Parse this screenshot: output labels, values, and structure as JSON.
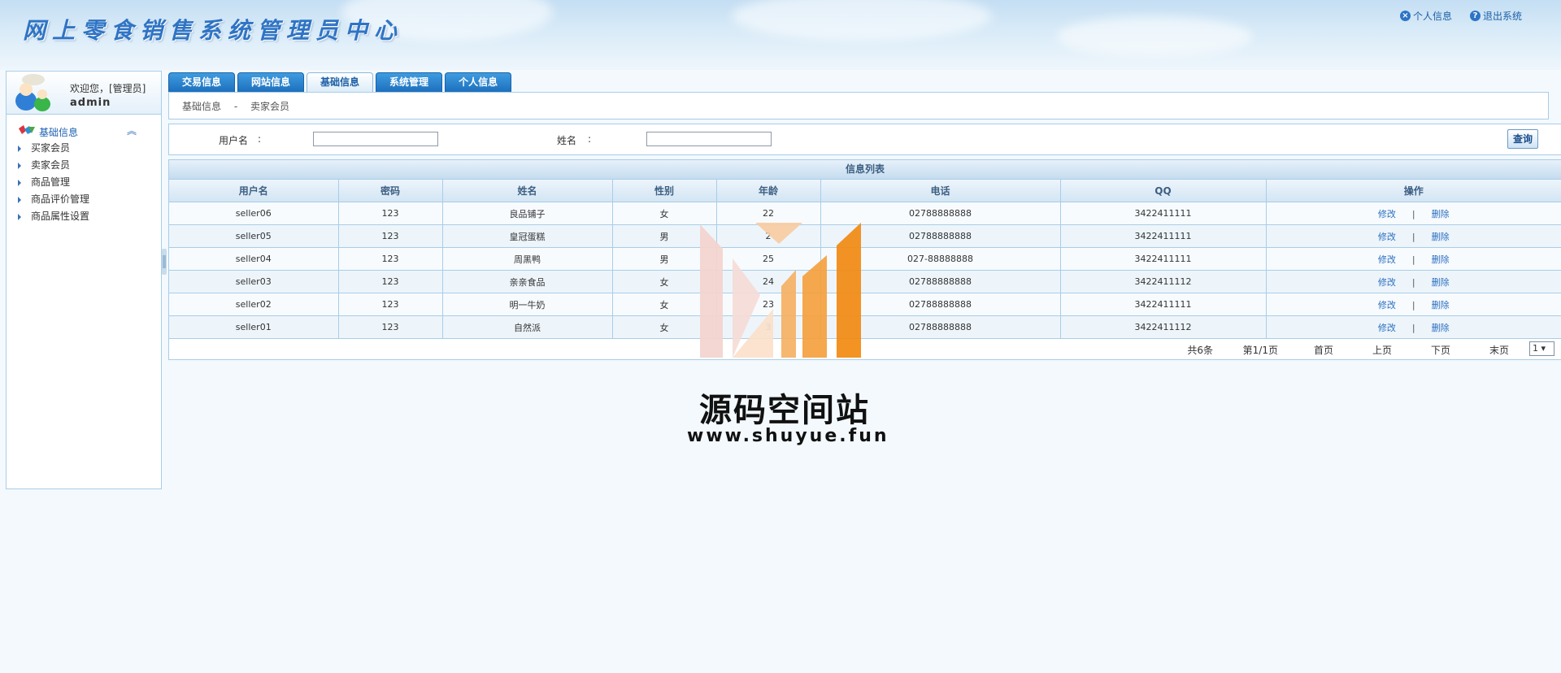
{
  "header": {
    "title": "网上零食销售系统管理员中心",
    "links": [
      {
        "label": "个人信息",
        "icon": "close-circle-icon"
      },
      {
        "label": "退出系统",
        "icon": "help-circle-icon"
      }
    ]
  },
  "sidebar": {
    "welcome": "欢迎您，[管理员]",
    "username": "admin",
    "section_title": "基础信息",
    "items": [
      "买家会员",
      "卖家会员",
      "商品管理",
      "商品评价管理",
      "商品属性设置"
    ]
  },
  "tabs": [
    "交易信息",
    "网站信息",
    "基础信息",
    "系统管理",
    "个人信息"
  ],
  "active_tab": "基础信息",
  "breadcrumb": {
    "parent": "基础信息",
    "sep": "-",
    "current": "卖家会员"
  },
  "search": {
    "username_label": "用户名",
    "name_label": "姓名",
    "colon": ":",
    "username_value": "",
    "name_value": "",
    "query_button": "查询"
  },
  "table": {
    "caption": "信息列表",
    "columns": [
      "用户名",
      "密码",
      "姓名",
      "性别",
      "年龄",
      "电话",
      "QQ",
      "操作"
    ],
    "rows": [
      [
        "seller06",
        "123",
        "良品铺子",
        "女",
        "22",
        "02788888888",
        "3422411111"
      ],
      [
        "seller05",
        "123",
        "皇冠蛋糕",
        "男",
        "2",
        "02788888888",
        "3422411111"
      ],
      [
        "seller04",
        "123",
        "周黑鸭",
        "男",
        "25",
        "027-88888888",
        "3422411111"
      ],
      [
        "seller03",
        "123",
        "亲亲食品",
        "女",
        "24",
        "02788888888",
        "3422411112"
      ],
      [
        "seller02",
        "123",
        "明一牛奶",
        "女",
        "23",
        "02788888888",
        "3422411111"
      ],
      [
        "seller01",
        "123",
        "自然派",
        "女",
        "3",
        "02788888888",
        "3422411112"
      ]
    ],
    "actions": {
      "edit": "修改",
      "sep": "|",
      "delete": "删除"
    }
  },
  "pager": {
    "total": "共6条",
    "page_info": "第1/1页",
    "first": "首页",
    "prev": "上页",
    "next": "下页",
    "last": "末页",
    "page_select": "1"
  },
  "watermark": {
    "name": "源码空间站",
    "url": "www.shuyue.fun"
  },
  "colors": {
    "tab_blue": "#1d6fbd",
    "link_blue": "#2a6ec0",
    "border": "#a9cde7",
    "wm_orange": "#f39a2a"
  }
}
